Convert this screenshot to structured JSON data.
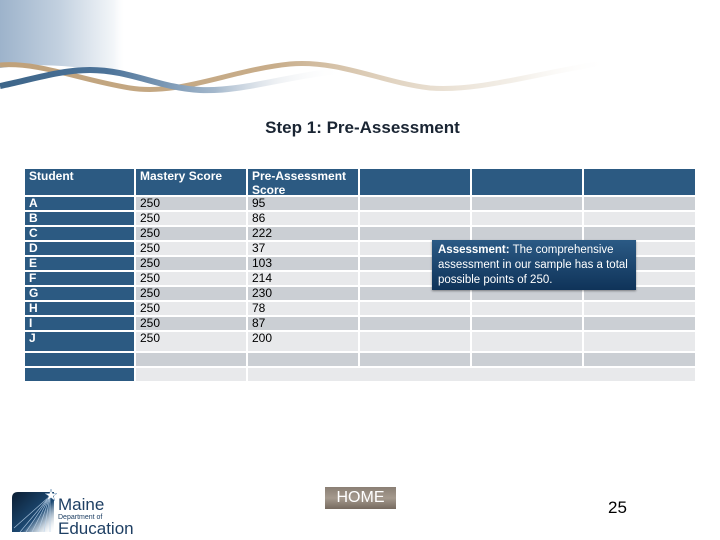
{
  "slide": {
    "title": "Step 1: Pre-Assessment",
    "page_number": "25",
    "home_label": "HOME"
  },
  "table": {
    "headers": [
      "Student",
      "Mastery Score",
      "Pre-Assessment Score",
      "",
      "",
      ""
    ],
    "rows": [
      {
        "student": "A",
        "mastery": "250",
        "pre": "95"
      },
      {
        "student": "B",
        "mastery": "250",
        "pre": "86"
      },
      {
        "student": "C",
        "mastery": "250",
        "pre": "222"
      },
      {
        "student": "D",
        "mastery": "250",
        "pre": "37"
      },
      {
        "student": "E",
        "mastery": "250",
        "pre": "103"
      },
      {
        "student": "F",
        "mastery": "250",
        "pre": "214"
      },
      {
        "student": "G",
        "mastery": "250",
        "pre": "230"
      },
      {
        "student": "H",
        "mastery": "250",
        "pre": "78"
      },
      {
        "student": "I",
        "mastery": "250",
        "pre": "87"
      },
      {
        "student": "J",
        "mastery": "250",
        "pre": "200"
      },
      {
        "student": "",
        "mastery": "",
        "pre": ""
      },
      {
        "student": "",
        "mastery": "",
        "pre": ""
      }
    ]
  },
  "callout": {
    "label": "Assessment:",
    "text": " The comprehensive assessment in our sample has a total possible points of 250."
  },
  "logo": {
    "line1": "Maine",
    "line2": "Department of",
    "line3": "Education"
  },
  "colors": {
    "header_blue": "#2c5a82",
    "row_dark": "#cbcfd4",
    "row_light": "#e8e9eb",
    "callout_bg": "#1b4670",
    "home_bg": "#8a7f74"
  }
}
